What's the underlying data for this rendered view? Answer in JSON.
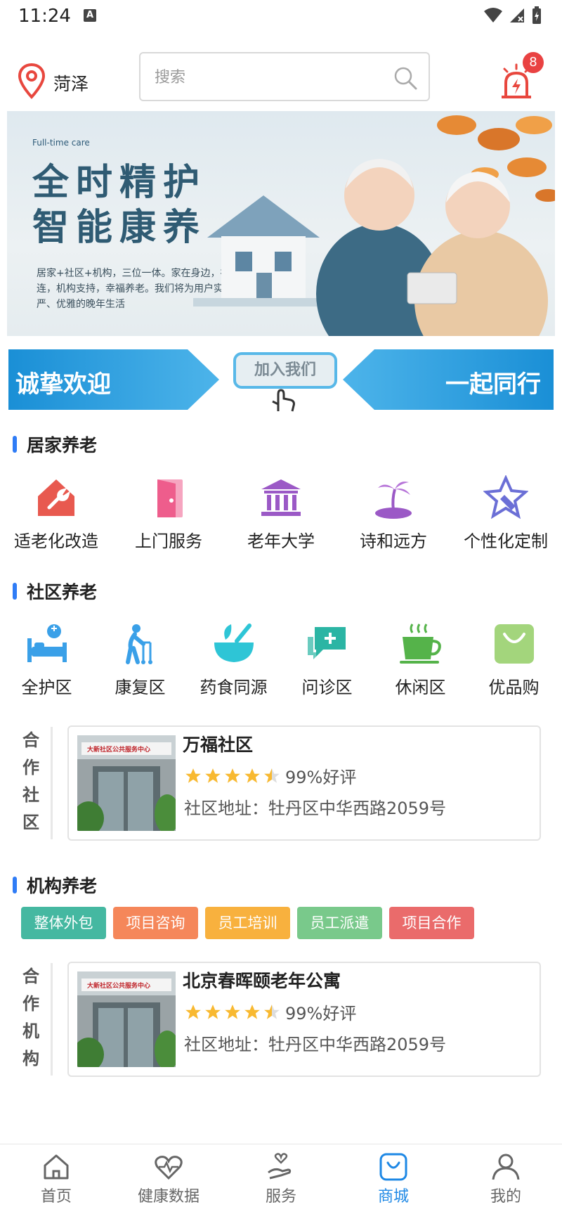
{
  "status_bar": {
    "time": "11:24",
    "notif_icon": "A"
  },
  "header": {
    "city": "菏泽",
    "search_placeholder": "搜索",
    "alarm_badge": "8"
  },
  "banner": {
    "brand": "Full-time care",
    "headline_1": "全时精护",
    "headline_2": "智能康养",
    "description": "居家+社区+机构，三位一体。家在身边，社区相连，机构支持，幸福养老。我们将为用户实现有尊严、优雅的晚年生活"
  },
  "welcome": {
    "left": "诚挚欢迎",
    "button": "加入我们",
    "right": "一起同行"
  },
  "home_care": {
    "title": "居家养老",
    "items": [
      {
        "label": "适老化改造",
        "icon": "house-wrench-icon",
        "color": "#e8594f"
      },
      {
        "label": "上门服务",
        "icon": "door-icon",
        "color": "#ee5d8c"
      },
      {
        "label": "老年大学",
        "icon": "university-icon",
        "color": "#9b59c6"
      },
      {
        "label": "诗和远方",
        "icon": "palm-island-icon",
        "color": "#9b59c6"
      },
      {
        "label": "个性化定制",
        "icon": "star-pen-icon",
        "color": "#6b6fd6"
      }
    ]
  },
  "community_care": {
    "title": "社区养老",
    "items": [
      {
        "label": "全护区",
        "icon": "nurse-bed-icon",
        "color": "#3aa0e8"
      },
      {
        "label": "康复区",
        "icon": "elderly-walker-icon",
        "color": "#3aa0e8"
      },
      {
        "label": "药食同源",
        "icon": "mortar-icon",
        "color": "#2ec5d6"
      },
      {
        "label": "问诊区",
        "icon": "chat-plus-icon",
        "color": "#2bb5a4"
      },
      {
        "label": "休闲区",
        "icon": "tea-cup-icon",
        "color": "#55b34a"
      },
      {
        "label": "优品购",
        "icon": "shopping-bag-icon",
        "color": "#a3d57c"
      }
    ]
  },
  "partner_community": {
    "side_label": [
      "合",
      "作",
      "社",
      "区"
    ],
    "name": "万福社区",
    "rating": "99%好评",
    "stars": 4.5,
    "address": "社区地址：牡丹区中华西路2059号",
    "image_sign": "大新社区公共服务中心"
  },
  "institution_care": {
    "title": "机构养老",
    "tags": [
      {
        "label": "整体外包",
        "color": "#45b8a1"
      },
      {
        "label": "项目咨询",
        "color": "#f5875a"
      },
      {
        "label": "员工培训",
        "color": "#f8b13e"
      },
      {
        "label": "员工派遣",
        "color": "#79c98b"
      },
      {
        "label": "项目合作",
        "color": "#ea6b6b"
      }
    ]
  },
  "partner_institution": {
    "side_label": [
      "合",
      "作",
      "机",
      "构"
    ],
    "name": "北京春晖颐老年公寓",
    "rating": "99%好评",
    "stars": 4.5,
    "address": "社区地址：牡丹区中华西路2059号",
    "image_sign": "大新社区公共服务中心"
  },
  "tabbar": {
    "items": [
      {
        "label": "首页",
        "icon": "home-icon",
        "active": false
      },
      {
        "label": "健康数据",
        "icon": "heartbeat-icon",
        "active": false
      },
      {
        "label": "服务",
        "icon": "hand-heart-icon",
        "active": false
      },
      {
        "label": "商城",
        "icon": "shop-bag-icon",
        "active": true
      },
      {
        "label": "我的",
        "icon": "user-icon",
        "active": false
      }
    ],
    "active_color": "#1e88e5"
  }
}
